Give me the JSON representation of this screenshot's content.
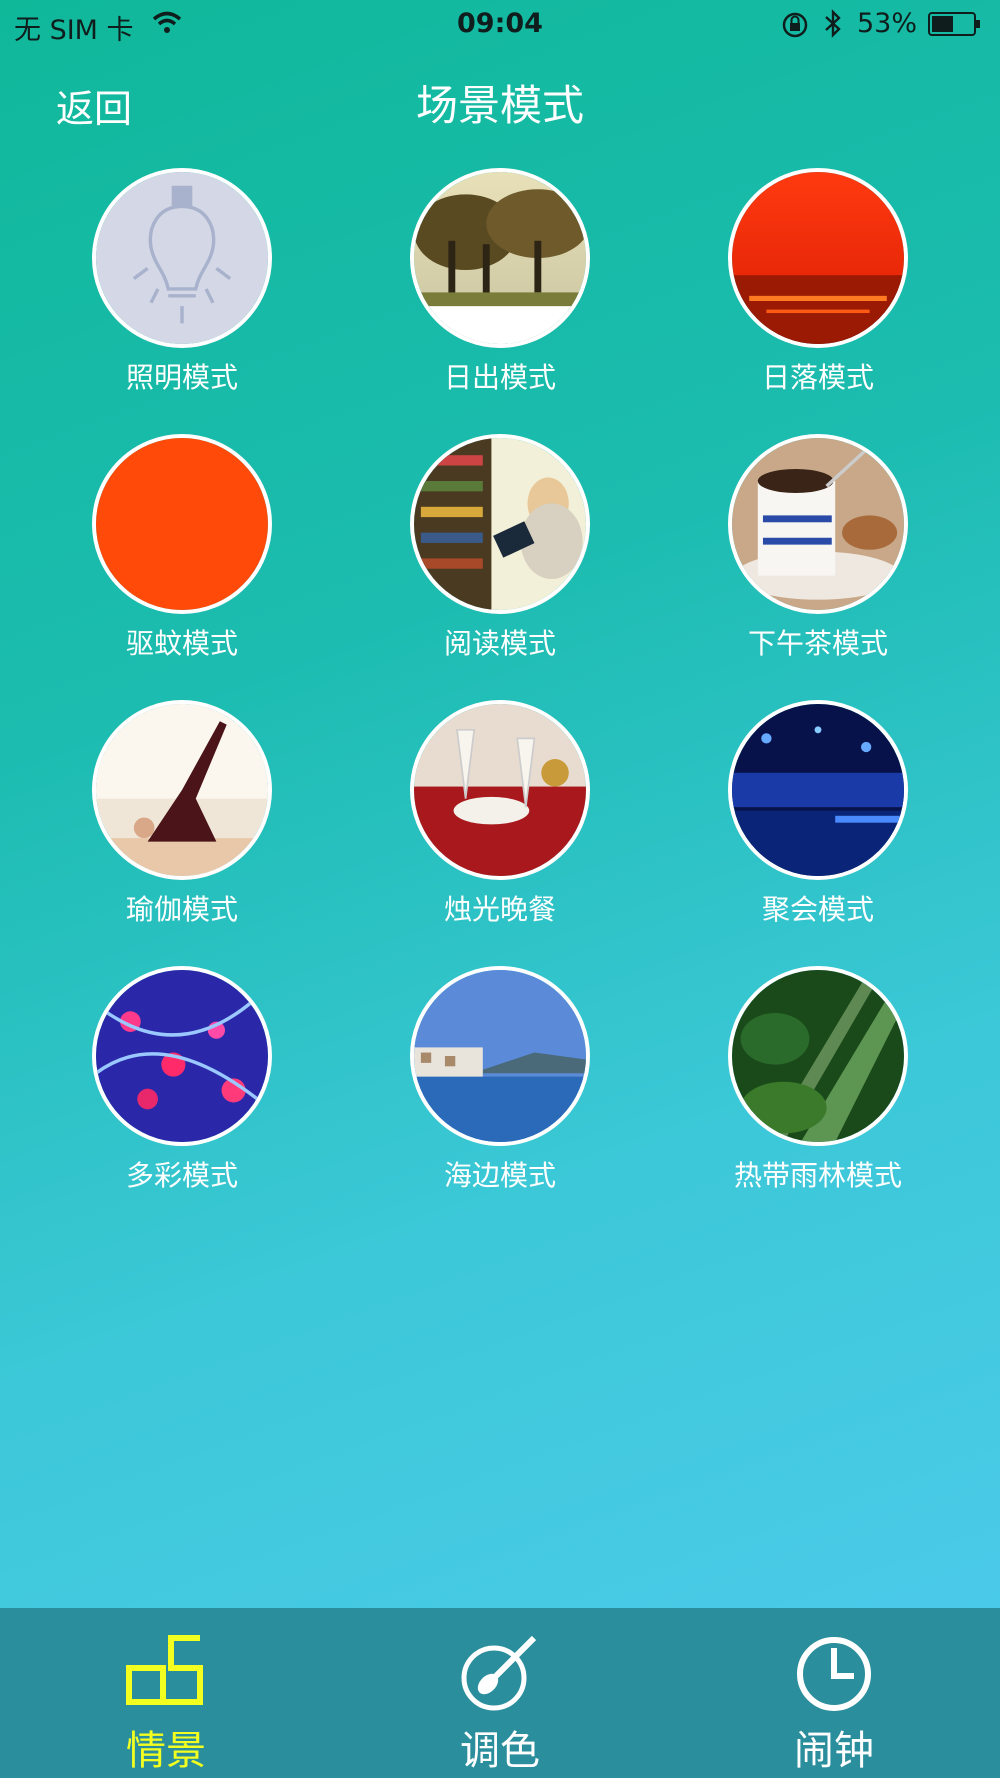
{
  "status_bar": {
    "carrier": "无 SIM 卡",
    "time": "09:04",
    "battery_percent": "53%",
    "battery_level": 0.53,
    "icons": [
      "wifi-icon",
      "orientation-lock-icon",
      "bluetooth-icon",
      "battery-icon"
    ]
  },
  "nav": {
    "back_label": "返回",
    "title": "场景模式"
  },
  "modes": [
    {
      "label": "照明模式",
      "icon": "lightbulb-image"
    },
    {
      "label": "日出模式",
      "icon": "sunrise-forest-image"
    },
    {
      "label": "日落模式",
      "icon": "sunset-sea-image"
    },
    {
      "label": "驱蚊模式",
      "icon": "orange-circle-image"
    },
    {
      "label": "阅读模式",
      "icon": "reading-library-image"
    },
    {
      "label": "下午茶模式",
      "icon": "tea-cup-image"
    },
    {
      "label": "瑜伽模式",
      "icon": "yoga-pose-image"
    },
    {
      "label": "烛光晚餐",
      "icon": "candle-dinner-image"
    },
    {
      "label": "聚会模式",
      "icon": "party-club-image"
    },
    {
      "label": "多彩模式",
      "icon": "colorful-lights-image"
    },
    {
      "label": "海边模式",
      "icon": "seaside-town-image"
    },
    {
      "label": "热带雨林模式",
      "icon": "rainforest-image"
    }
  ],
  "tabs": [
    {
      "label": "情景",
      "icon": "scene-icon",
      "active": true
    },
    {
      "label": "调色",
      "icon": "palette-brush-icon",
      "active": false
    },
    {
      "label": "闹钟",
      "icon": "clock-icon",
      "active": false
    }
  ],
  "colors": {
    "active_tab": "#f3ff1e",
    "tab_bar": "#2b8e9c",
    "gradient_start": "#10b89a",
    "gradient_end": "#4fcbee"
  }
}
